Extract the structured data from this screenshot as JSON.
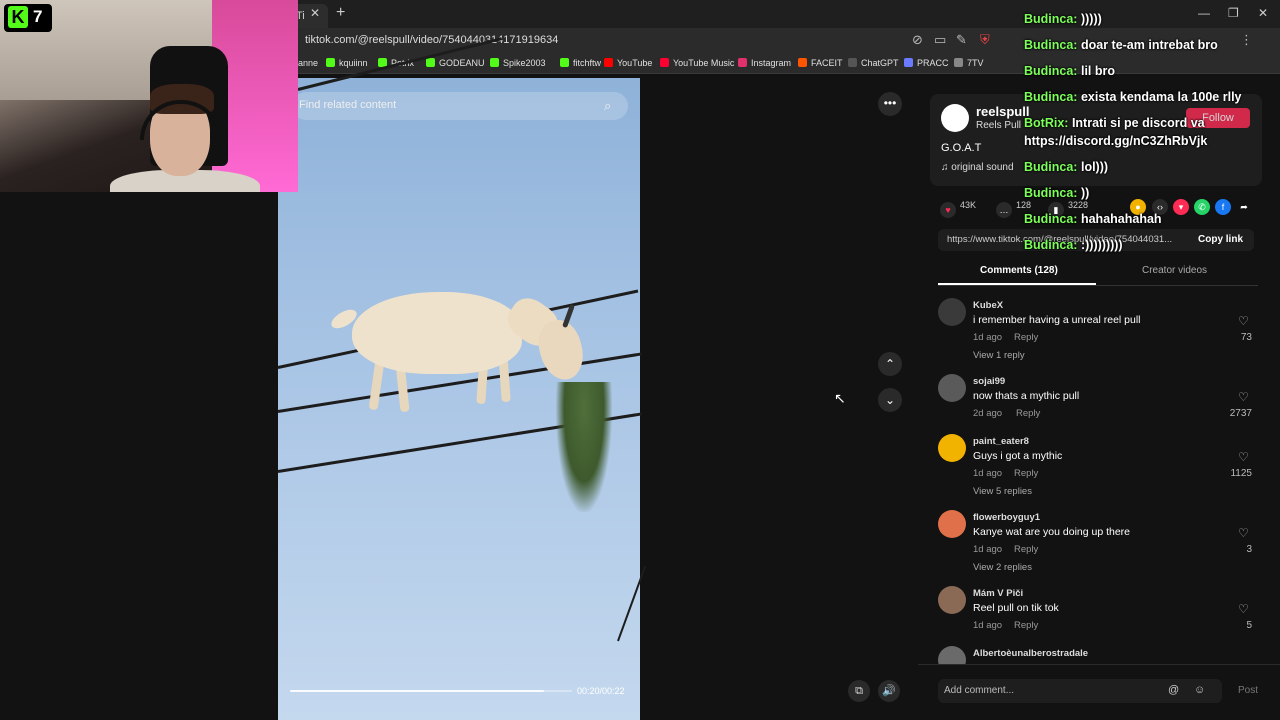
{
  "kick": {
    "logo": "K",
    "viewers": "7"
  },
  "browser": {
    "tab_label": "Ti",
    "url": "tiktok.com/@reelspull/video/7540440314171919634",
    "bookmarks": [
      {
        "label": "anne",
        "color": "#2b2b2b"
      },
      {
        "label": "kquiinn",
        "color": "#53fc18"
      },
      {
        "label": "Potrix",
        "color": "#53fc18"
      },
      {
        "label": "GODEANU",
        "color": "#53fc18"
      },
      {
        "label": "Spike2003",
        "color": "#53fc18"
      },
      {
        "label": "fitchftw",
        "color": "#53fc18"
      },
      {
        "label": "YouTube",
        "color": "#ff0000"
      },
      {
        "label": "YouTube Music",
        "color": "#ff0033"
      },
      {
        "label": "Instagram",
        "color": "#e1306c"
      },
      {
        "label": "FACEIT",
        "color": "#ff5500"
      },
      {
        "label": "ChatGPT",
        "color": "#555555"
      },
      {
        "label": "PRACC",
        "color": "#6a7bff"
      },
      {
        "label": "7TV",
        "color": "#888888"
      }
    ]
  },
  "video": {
    "search_placeholder": "Find related content",
    "time": "00:20/00:22",
    "progress_fraction": 0.9
  },
  "post": {
    "username": "reelspull",
    "display_name": "Reels Pull",
    "follow_label": "Follow",
    "caption": "G.O.A.T",
    "sound": "original sound",
    "likes": "43K",
    "comments": "128",
    "saves": "3228",
    "link": "https://www.tiktok.com/@reelspull/video/754044031...",
    "copy_label": "Copy link",
    "tab_comments": "Comments (128)",
    "tab_creator": "Creator videos"
  },
  "comments": [
    {
      "user": "KubeX",
      "text": "i remember having a unreal reel pull",
      "age": "1d ago",
      "reply": "Reply",
      "likes": "73",
      "view_replies": "View 1 reply",
      "avatar": "#3a3a3a"
    },
    {
      "user": "sojai99",
      "text": "now thats a mythic pull",
      "age": "2d ago",
      "reply": "Reply",
      "likes": "2737",
      "view_replies": "",
      "avatar": "#5a5a5a"
    },
    {
      "user": "paint_eater8",
      "text": "Guys i got a mythic",
      "age": "1d ago",
      "reply": "Reply",
      "likes": "1125",
      "view_replies": "View 5 replies",
      "avatar": "#f2b200"
    },
    {
      "user": "flowerboyguy1",
      "text": "Kanye wat are you doing up there",
      "age": "1d ago",
      "reply": "Reply",
      "likes": "3",
      "view_replies": "View 2 replies",
      "avatar": "#e0704a"
    },
    {
      "user": "Mám V Piči",
      "text": "Reel pull on tik tok",
      "age": "1d ago",
      "reply": "Reply",
      "likes": "5",
      "view_replies": "",
      "avatar": "#8a6a55"
    },
    {
      "user": "Albertoèunalberostradale",
      "text": "",
      "age": "",
      "reply": "",
      "likes": "",
      "view_replies": "",
      "avatar": "#6a6a6a"
    }
  ],
  "add_comment": {
    "placeholder": "Add comment...",
    "post_label": "Post"
  },
  "chat": [
    {
      "name": "Budinca:",
      "msg": ")))))"
    },
    {
      "name": "Budinca:",
      "msg": "doar te-am intrebat bro"
    },
    {
      "name": "Budinca:",
      "msg": "lil bro"
    },
    {
      "name": "Budinca:",
      "msg": "exista kendama la 100e rlly"
    },
    {
      "name": "BotRix:",
      "msg": "Intrati si pe discord va"
    },
    {
      "name": "",
      "msg": "https://discord.gg/nC3ZhRbVjk"
    },
    {
      "name": "Budinca:",
      "msg": "lol)))"
    },
    {
      "name": "Budinca:",
      "msg": "))"
    },
    {
      "name": "Budinca:",
      "msg": "hahahahahah"
    },
    {
      "name": "Budinca:",
      "msg": ":)))))))))"
    }
  ]
}
